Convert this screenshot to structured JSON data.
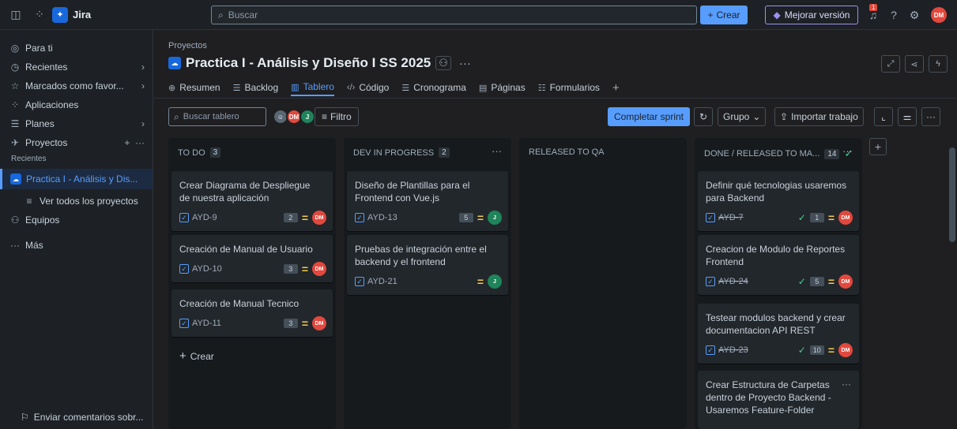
{
  "topbar": {
    "app_name": "Jira",
    "search_placeholder": "Buscar",
    "create_label": "Crear",
    "upgrade_label": "Mejorar versión",
    "notification_count": "1",
    "user_initials": "DM"
  },
  "sidebar": {
    "items": [
      {
        "label": "Para ti"
      },
      {
        "label": "Recientes"
      },
      {
        "label": "Marcados como favor..."
      },
      {
        "label": "Aplicaciones"
      },
      {
        "label": "Planes"
      },
      {
        "label": "Proyectos"
      }
    ],
    "recent_label": "Recientes",
    "active_project": "Practica I - Análisis y Dis...",
    "all_projects": "Ver todos los proyectos",
    "teams": "Equipos",
    "more": "Más",
    "feedback": "Enviar comentarios sobr..."
  },
  "header": {
    "breadcrumb": "Proyectos",
    "title": "Practica I - Análisis y Diseño I SS 2025"
  },
  "tabs": [
    {
      "label": "Resumen"
    },
    {
      "label": "Backlog"
    },
    {
      "label": "Tablero"
    },
    {
      "label": "Código"
    },
    {
      "label": "Cronograma"
    },
    {
      "label": "Páginas"
    },
    {
      "label": "Formularios"
    }
  ],
  "toolbar": {
    "search_placeholder": "Buscar tablero",
    "avatar_1": "DM",
    "avatar_2": "J",
    "filter_label": "Filtro",
    "complete_sprint": "Completar sprint",
    "group_label": "Grupo",
    "import_label": "Importar trabajo"
  },
  "columns": [
    {
      "title": "TO DO",
      "count": "3",
      "create_label": "Crear",
      "cards": [
        {
          "title": "Crear Diagrama de Despliegue de nuestra aplicación",
          "key": "AYD-9",
          "points": "2",
          "assignee": "DM"
        },
        {
          "title": "Creación de Manual de Usuario",
          "key": "AYD-10",
          "points": "3",
          "assignee": "DM"
        },
        {
          "title": "Creación de Manual Tecnico",
          "key": "AYD-11",
          "points": "3",
          "assignee": "DM"
        }
      ]
    },
    {
      "title": "DEV IN PROGRESS",
      "count": "2",
      "cards": [
        {
          "title": "Diseño de Plantillas para el Frontend con Vue.js",
          "key": "AYD-13",
          "points": "5",
          "assignee": "J"
        },
        {
          "title": "Pruebas de integración entre el backend y el frontend",
          "key": "AYD-21",
          "assignee": "J"
        }
      ]
    },
    {
      "title": "RELEASED TO QA",
      "cards": []
    },
    {
      "title": "DONE / RELEASED TO MA...",
      "count": "14",
      "cards": [
        {
          "title": "Definir qué tecnologias usaremos para Backend",
          "key": "AYD-7",
          "points": "1",
          "assignee": "DM"
        },
        {
          "title": "Creacion de Modulo de Reportes Frontend",
          "key": "AYD-24",
          "points": "5",
          "assignee": "DM"
        },
        {
          "title": "Testear modulos backend y crear documentacion API REST",
          "key": "AYD-23",
          "points": "10",
          "assignee": "DM"
        },
        {
          "title": "Crear Estructura de Carpetas dentro de Proyecto Backend - Usaremos Feature-Folder"
        }
      ]
    }
  ]
}
